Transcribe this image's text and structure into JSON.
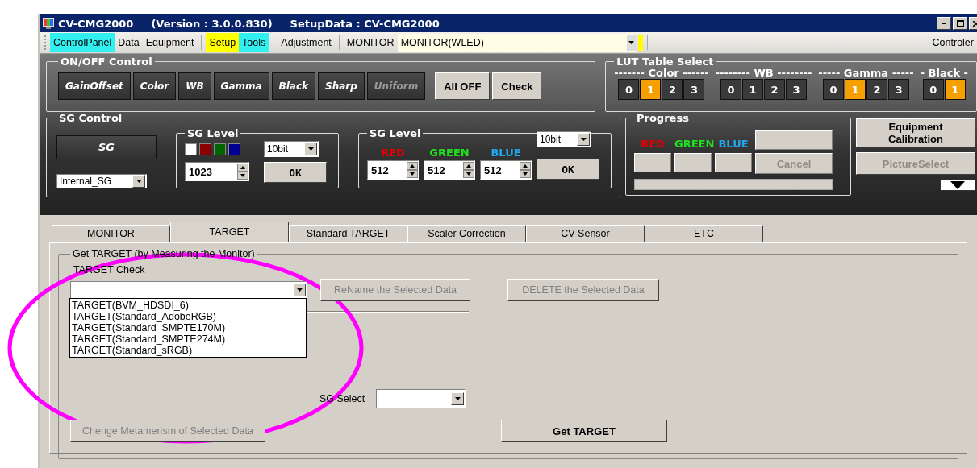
{
  "window": {
    "title": "CV-CMG2000",
    "version": "(Version : 3.0.0.830)",
    "setup_data": "SetupData : CV-CMG2000"
  },
  "toolbar": {
    "groups": [
      [
        {
          "label": "ControlPanel",
          "color": "#33f0f0"
        },
        {
          "label": "Data"
        },
        {
          "label": "Equipment"
        }
      ],
      [
        {
          "label": "Setup",
          "color": "#ffff00"
        },
        {
          "label": "Tools",
          "color": "#33f0f0"
        }
      ],
      [
        {
          "label": "Adjustment"
        }
      ]
    ],
    "monitor_label": "MONITOR",
    "monitor_combo": "MONITOR(WLED)",
    "controller_label": "Controler"
  },
  "on_off": {
    "title": "ON/OFF Control",
    "toggles": [
      {
        "label": "GainOffset",
        "disabled": false
      },
      {
        "label": "Color",
        "disabled": false
      },
      {
        "label": "WB",
        "disabled": false
      },
      {
        "label": "Gamma",
        "disabled": false
      },
      {
        "label": "Black",
        "disabled": false
      },
      {
        "label": "Sharp",
        "disabled": false
      },
      {
        "label": "Uniform",
        "disabled": true
      }
    ],
    "buttons": [
      "All OFF",
      "Check"
    ]
  },
  "lut": {
    "title": "LUT Table Select",
    "groups": [
      {
        "label": "------- Color ------",
        "options": [
          {
            "label": "0",
            "selected": false
          },
          {
            "label": "1",
            "selected": true
          },
          {
            "label": "2",
            "selected": false
          },
          {
            "label": "3",
            "selected": false
          }
        ]
      },
      {
        "label": "-------- WB --------",
        "options": [
          {
            "label": "0",
            "selected": false
          },
          {
            "label": "1",
            "selected": false
          },
          {
            "label": "2",
            "selected": false
          },
          {
            "label": "3",
            "selected": false
          }
        ]
      },
      {
        "label": "----- Gamma -----",
        "options": [
          {
            "label": "0",
            "selected": false
          },
          {
            "label": "1",
            "selected": true
          },
          {
            "label": "2",
            "selected": false
          },
          {
            "label": "3",
            "selected": false
          }
        ]
      },
      {
        "label": "- Black -",
        "options": [
          {
            "label": "0",
            "selected": false
          },
          {
            "label": "1",
            "selected": true
          }
        ]
      }
    ]
  },
  "sg_control": {
    "title": "SG Control",
    "sg_button": "SG",
    "source": "Internal_SG",
    "level_single": {
      "title": "SG Level",
      "swatches": [
        {
          "color": "#ffffff"
        },
        {
          "color": "#8b0000"
        },
        {
          "color": "#006400"
        },
        {
          "color": "#000090"
        }
      ],
      "bit": "10bit",
      "value": "1023",
      "ok": "OK"
    },
    "level_rgb": {
      "title": "SG Level",
      "channels": [
        {
          "label": "RED",
          "color": "#e00000",
          "value": "512"
        },
        {
          "label": "GREEN",
          "color": "#20e020",
          "value": "512"
        },
        {
          "label": "BLUE",
          "color": "#20a8f0",
          "value": "512"
        }
      ],
      "bit": "10bit",
      "ok": "OK"
    }
  },
  "progress": {
    "title": "Progress",
    "channels": [
      {
        "label": "RED",
        "color": "#e00000"
      },
      {
        "label": "GREEN",
        "color": "#20e020"
      },
      {
        "label": "BLUE",
        "color": "#20a8f0"
      }
    ],
    "cancel": {
      "label": "Cancel",
      "disabled": true
    }
  },
  "side_buttons": [
    {
      "label": "Equipment Calibration",
      "disabled": false
    },
    {
      "label": "PictureSelect",
      "disabled": true
    }
  ],
  "tabs": [
    {
      "label": "MONITOR",
      "selected": false
    },
    {
      "label": "TARGET",
      "selected": true
    },
    {
      "label": "Standard TARGET",
      "selected": false
    },
    {
      "label": "Scaler Correction",
      "selected": false
    },
    {
      "label": "CV-Sensor",
      "selected": false
    },
    {
      "label": "ETC",
      "selected": false
    }
  ],
  "get_target": {
    "title": "Get TARGET (by Measuring the Monitor)",
    "target_check_label": "TARGET Check",
    "dropdown_options": [
      "TARGET(BVM_HDSDI_6)",
      "TARGET(Standard_AdobeRGB)",
      "TARGET(Standard_SMPTE170M)",
      "TARGET(Standard_SMPTE274M)",
      "TARGET(Standard_sRGB)"
    ],
    "rename": {
      "label": "ReName the Selected Data",
      "disabled": true
    },
    "delete": {
      "label": "DELETE the Selected Data",
      "disabled": true
    },
    "sg_select_label": "SG Select",
    "metamerism": {
      "label": "Chenge Metamerism of Selected Data",
      "disabled": true
    },
    "get_target": {
      "label": "Get TARGET",
      "disabled": false
    }
  }
}
